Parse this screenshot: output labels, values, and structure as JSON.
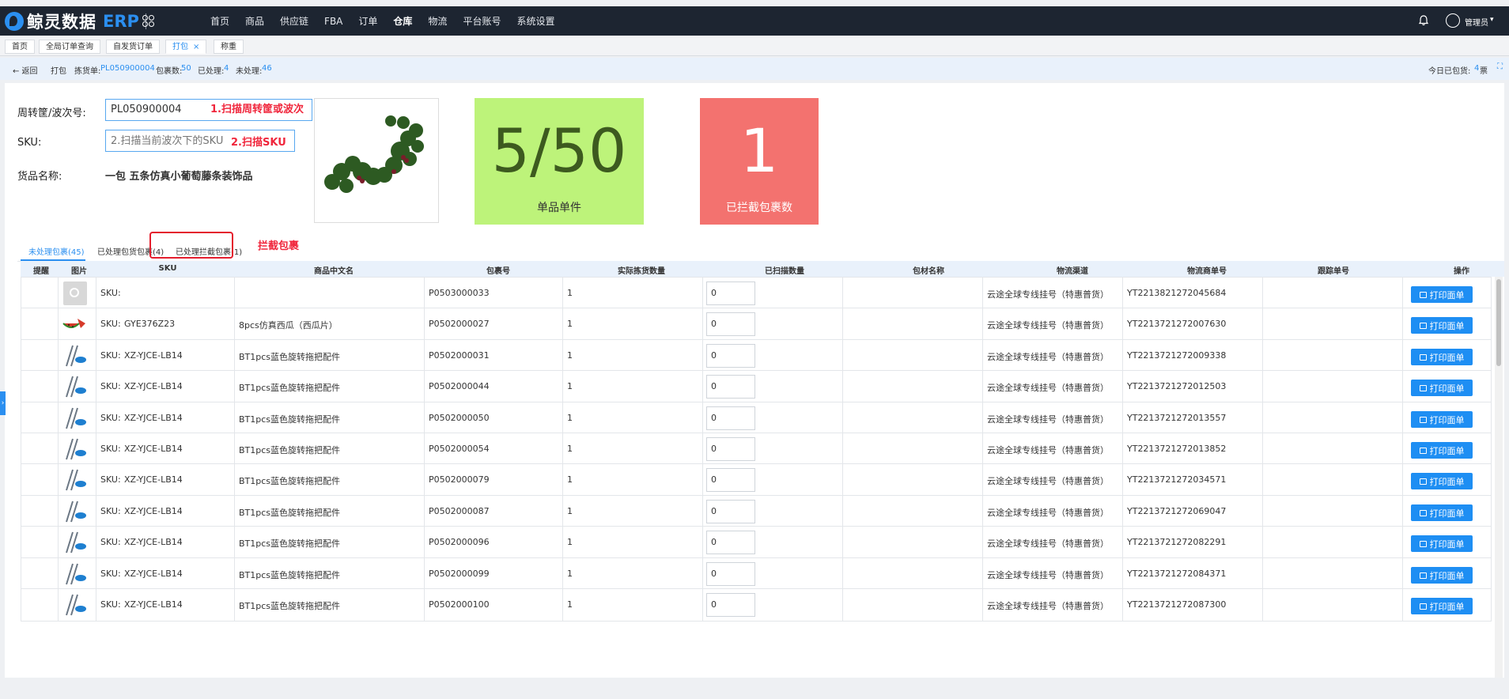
{
  "app": {
    "logo_text": "鲸灵数据",
    "logo_suffix": "ERP"
  },
  "nav": [
    "首页",
    "商品",
    "供应链",
    "FBA",
    "订单",
    "仓库",
    "物流",
    "平台账号",
    "系统设置"
  ],
  "user": {
    "name": "管理员"
  },
  "tabs": [
    {
      "label": "首页"
    },
    {
      "label": "全局订单查询"
    },
    {
      "label": "自发货订单"
    },
    {
      "label": "打包",
      "close": "×"
    },
    {
      "label": "称重"
    }
  ],
  "crumbs": {
    "back": "← 返回",
    "page": "打包",
    "pick_label": "拣货单:",
    "pick_value": "PL050900004",
    "pkg_label": "包裹数:",
    "pkg_value": "50",
    "done_label": "已处理:",
    "done_value": "4",
    "pending_label": "未处理:",
    "pending_value": "46",
    "today_label": "今日已包货:",
    "today_value": "4",
    "today_unit": "票"
  },
  "form": {
    "wave_label": "周转筐/波次号:",
    "wave_value": "PL050900004",
    "wave_hint": "1.扫描周转筐或波次",
    "sku_label": "SKU:",
    "sku_placeholder": "2.扫描当前波次下的SKU",
    "sku_hint": "2.扫描SKU",
    "goods_label": "货品名称:",
    "goods_value": "一包 五条仿真小葡萄藤条装饰品"
  },
  "counter": {
    "value": "5/50",
    "caption": "单品单件"
  },
  "blocked": {
    "value": "1",
    "caption": "已拦截包裹数"
  },
  "subtabs": [
    "未处理包裹(45)",
    "已处理包货包裹(4)",
    "已处理拦截包裹(1)"
  ],
  "annotation": "拦截包裹",
  "table": {
    "headers": [
      "提醒",
      "图片",
      "SKU",
      "商品中文名",
      "包裹号",
      "实际拣货数量",
      "已扫描数量",
      "包材名称",
      "物流渠道",
      "物流商单号",
      "跟踪单号",
      "操作"
    ],
    "print_label": "打印面单",
    "sku_prefix": "SKU:",
    "rows": [
      {
        "sku": "",
        "name": "",
        "pkg": "P0503000033",
        "qty": "1",
        "scanned": "0",
        "channel": "云途全球专线挂号（特惠普货）",
        "tracking": "YT2213821272045684",
        "img": "placeholder"
      },
      {
        "sku": "GYE376Z23",
        "name": "8pcs仿真西瓜（西瓜片）",
        "pkg": "P0502000027",
        "qty": "1",
        "scanned": "0",
        "channel": "云途全球专线挂号（特惠普货）",
        "tracking": "YT2213721272007630",
        "img": "watermelon"
      },
      {
        "sku": "XZ-YJCE-LB14",
        "name": "BT1pcs蓝色旋转拖把配件",
        "pkg": "P0502000031",
        "qty": "1",
        "scanned": "0",
        "channel": "云途全球专线挂号（特惠普货）",
        "tracking": "YT2213721272009338",
        "img": "mop"
      },
      {
        "sku": "XZ-YJCE-LB14",
        "name": "BT1pcs蓝色旋转拖把配件",
        "pkg": "P0502000044",
        "qty": "1",
        "scanned": "0",
        "channel": "云途全球专线挂号（特惠普货）",
        "tracking": "YT2213721272012503",
        "img": "mop"
      },
      {
        "sku": "XZ-YJCE-LB14",
        "name": "BT1pcs蓝色旋转拖把配件",
        "pkg": "P0502000050",
        "qty": "1",
        "scanned": "0",
        "channel": "云途全球专线挂号（特惠普货）",
        "tracking": "YT2213721272013557",
        "img": "mop"
      },
      {
        "sku": "XZ-YJCE-LB14",
        "name": "BT1pcs蓝色旋转拖把配件",
        "pkg": "P0502000054",
        "qty": "1",
        "scanned": "0",
        "channel": "云途全球专线挂号（特惠普货）",
        "tracking": "YT2213721272013852",
        "img": "mop"
      },
      {
        "sku": "XZ-YJCE-LB14",
        "name": "BT1pcs蓝色旋转拖把配件",
        "pkg": "P0502000079",
        "qty": "1",
        "scanned": "0",
        "channel": "云途全球专线挂号（特惠普货）",
        "tracking": "YT2213721272034571",
        "img": "mop"
      },
      {
        "sku": "XZ-YJCE-LB14",
        "name": "BT1pcs蓝色旋转拖把配件",
        "pkg": "P0502000087",
        "qty": "1",
        "scanned": "0",
        "channel": "云途全球专线挂号（特惠普货）",
        "tracking": "YT2213721272069047",
        "img": "mop"
      },
      {
        "sku": "XZ-YJCE-LB14",
        "name": "BT1pcs蓝色旋转拖把配件",
        "pkg": "P0502000096",
        "qty": "1",
        "scanned": "0",
        "channel": "云途全球专线挂号（特惠普货）",
        "tracking": "YT2213721272082291",
        "img": "mop"
      },
      {
        "sku": "XZ-YJCE-LB14",
        "name": "BT1pcs蓝色旋转拖把配件",
        "pkg": "P0502000099",
        "qty": "1",
        "scanned": "0",
        "channel": "云途全球专线挂号（特惠普货）",
        "tracking": "YT2213721272084371",
        "img": "mop"
      },
      {
        "sku": "XZ-YJCE-LB14",
        "name": "BT1pcs蓝色旋转拖把配件",
        "pkg": "P0502000100",
        "qty": "1",
        "scanned": "0",
        "channel": "云途全球专线挂号（特惠普货）",
        "tracking": "YT2213721272087300",
        "img": "mop"
      }
    ]
  },
  "colors": {
    "primary": "#2b8ff0",
    "topbar": "#1d2531",
    "counter": "#bdf37a",
    "blocked": "#f3726f",
    "alert": "#f0263c"
  }
}
